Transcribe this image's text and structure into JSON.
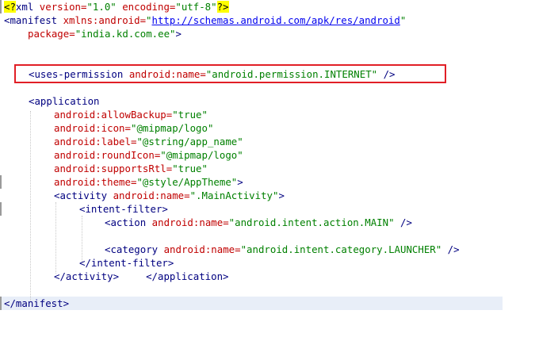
{
  "editor": {
    "lines": {
      "decl": {
        "open": "<?",
        "name": "xml",
        "a1": " version=",
        "v1": "\"1.0\"",
        "a2": " encoding=",
        "v2": "\"utf-8\"",
        "close": "?>"
      },
      "manifest_open": {
        "tag": "<manifest",
        "attr": " xmlns:android=",
        "q1": "\"",
        "url": "http://schemas.android.com/apk/res/android",
        "q2": "\""
      },
      "package": {
        "attr": "package=",
        "val": "\"india.kd.com.ee\"",
        "end": ">"
      },
      "uses_permission": {
        "tag": "<uses-permission",
        "attr": " android:name=",
        "val": "\"android.permission.INTERNET\"",
        "end": " />"
      },
      "application_open": {
        "tag": "<application"
      },
      "allowBackup": {
        "attr": "android:allowBackup=",
        "val": "\"true\""
      },
      "icon": {
        "attr": "android:icon=",
        "val": "\"@mipmap/logo\""
      },
      "label": {
        "attr": "android:label=",
        "val": "\"@string/app_name\""
      },
      "roundIcon": {
        "attr": "android:roundIcon=",
        "val": "\"@mipmap/logo\""
      },
      "supportsRtl": {
        "attr": "android:supportsRtl=",
        "val": "\"true\""
      },
      "theme": {
        "attr": "android:theme=",
        "val": "\"@style/AppTheme\"",
        "end": ">"
      },
      "activity_open": {
        "tag": "<activity",
        "attr": " android:name=",
        "val": "\".MainActivity\"",
        "end": ">"
      },
      "intent_filter_open": {
        "tag": "<intent-filter>"
      },
      "action": {
        "tag": "<action",
        "attr": " android:name=",
        "val": "\"android.intent.action.MAIN\"",
        "end": " />"
      },
      "category": {
        "tag": "<category",
        "attr": " android:name=",
        "val": "\"android.intent.category.LAUNCHER\"",
        "end": " />"
      },
      "intent_filter_close": {
        "tag": "</intent-filter>"
      },
      "activity_close": {
        "tag1": "</activity>",
        "tag2": "</application>"
      },
      "manifest_close": {
        "tag": "</manifest>"
      }
    }
  },
  "colors": {
    "tag": "#000080",
    "attribute": "#c00000",
    "string": "#008000",
    "highlight_box": "#e11f26",
    "declaration_marker": "#ffff00"
  }
}
